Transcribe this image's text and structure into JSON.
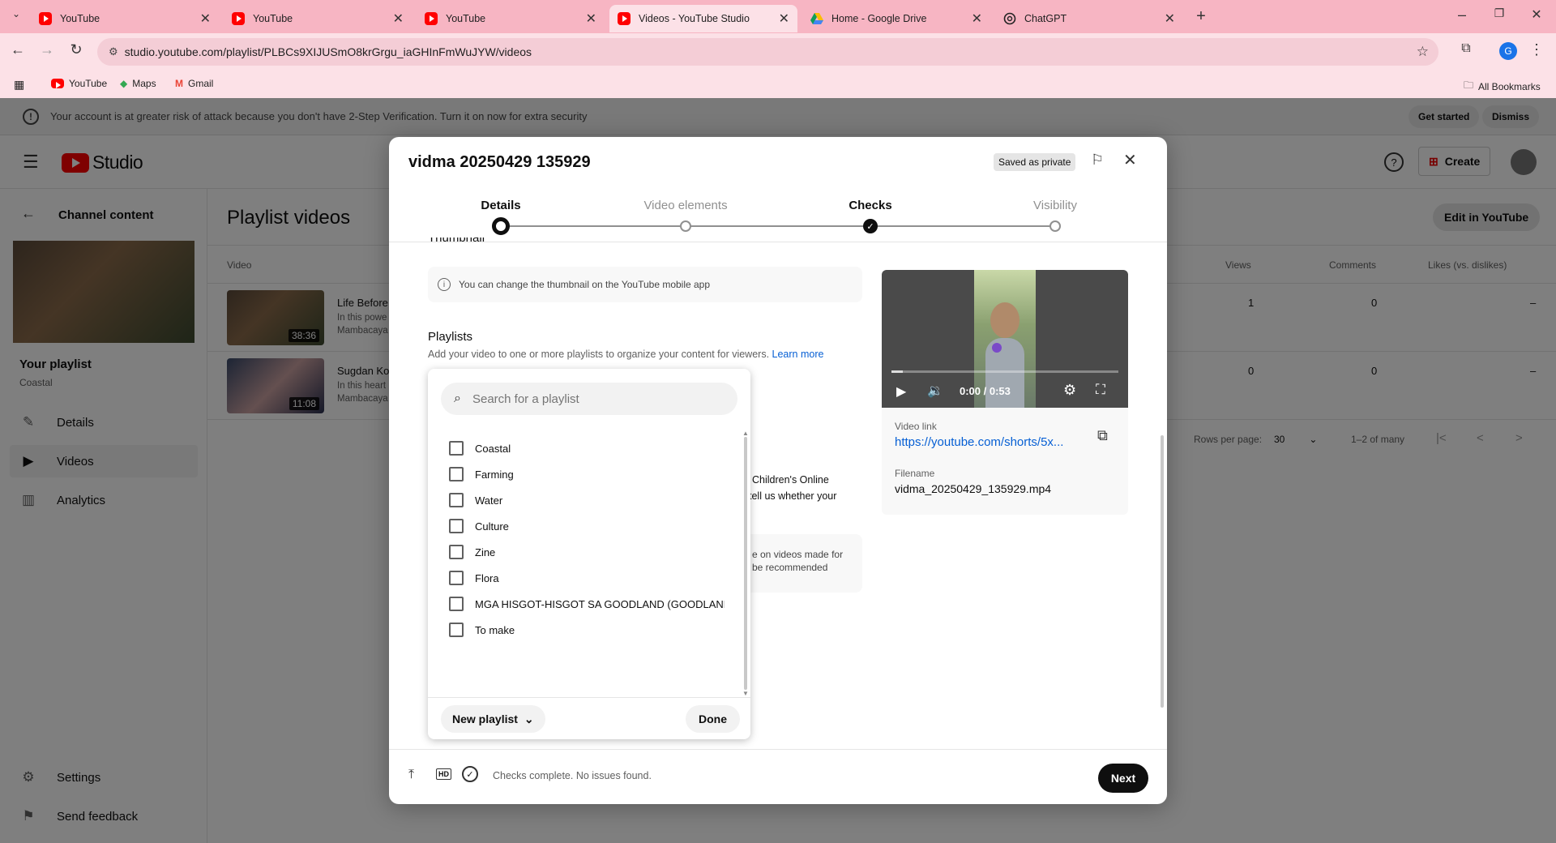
{
  "browser": {
    "tabs": [
      {
        "label": "YouTube",
        "icon": "youtube-icon"
      },
      {
        "label": "YouTube",
        "icon": "youtube-icon"
      },
      {
        "label": "YouTube",
        "icon": "youtube-icon"
      },
      {
        "label": "Videos - YouTube Studio",
        "icon": "youtube-icon"
      },
      {
        "label": "Home - Google Drive",
        "icon": "google-drive-icon"
      },
      {
        "label": "ChatGPT",
        "icon": "chatgpt-icon"
      }
    ],
    "url": "studio.youtube.com/playlist/PLBCs9XIJUSmO8krGrgu_iaGHInFmWuJYW/videos",
    "profile_initial": "G",
    "bookmarks": [
      {
        "label": "YouTube"
      },
      {
        "label": "Maps"
      },
      {
        "label": "Gmail"
      }
    ],
    "all_bookmarks": "All Bookmarks"
  },
  "banner": {
    "text": "Your account is at greater risk of attack because you don't have 2-Step Verification. Turn it on now for extra security",
    "get_started": "Get started",
    "dismiss": "Dismiss"
  },
  "studio": {
    "logo_text": "Studio",
    "create": "Create",
    "channel_content": "Channel content",
    "page_title": "Playlist videos",
    "edit_in_youtube": "Edit in YouTube",
    "playlist_label": "Your playlist",
    "playlist_name": "Coastal",
    "nav": [
      {
        "label": "Details",
        "icon": "pencil-icon"
      },
      {
        "label": "Videos",
        "icon": "videos-icon"
      },
      {
        "label": "Analytics",
        "icon": "analytics-icon"
      }
    ],
    "settings": "Settings",
    "send_feedback": "Send feedback",
    "columns": {
      "video": "Video",
      "views": "Views",
      "comments": "Comments",
      "likes": "Likes (vs. dislikes)"
    },
    "rows": [
      {
        "title": "Life Before",
        "desc1": "In this powe",
        "desc2": "Mambacaya",
        "duration": "38:36",
        "views": "1",
        "comments": "0",
        "likes": "–"
      },
      {
        "title": "Sugdan Ko",
        "desc1": "In this heart",
        "desc2": "Mambacaya",
        "duration": "11:08",
        "views": "0",
        "comments": "0",
        "likes": "–"
      }
    ],
    "rows_per_page_label": "Rows per page:",
    "rows_per_page": "30",
    "range": "1–2 of many"
  },
  "modal": {
    "title": "vidma 20250429 135929",
    "saved_badge": "Saved as private",
    "steps": [
      {
        "label": "Details",
        "state": "current"
      },
      {
        "label": "Video elements",
        "state": "pending"
      },
      {
        "label": "Checks",
        "state": "done"
      },
      {
        "label": "Visibility",
        "state": "pending"
      }
    ],
    "thumbnail_title_partial": "Thumbnail",
    "thumbnail_info": "You can change the thumbnail on the YouTube mobile app",
    "playlists_title": "Playlists",
    "playlists_desc": "Add your video to one or more playlists to organize your content for viewers.",
    "learn_more": "Learn more",
    "hidden_text_1a": "Children's Online",
    "hidden_text_1b": "tell us whether your",
    "hidden_text_2a": "e on videos made for",
    "hidden_text_2b": "be recommended",
    "video": {
      "time": "0:00 / 0:53",
      "progress": 0.05,
      "link_label": "Video link",
      "link": "https://youtube.com/shorts/5x...",
      "filename_label": "Filename",
      "filename": "vidma_20250429_135929.mp4"
    },
    "footer_status": "Checks complete. No issues found.",
    "next": "Next"
  },
  "playlist_dropdown": {
    "search_placeholder": "Search for a playlist",
    "items": [
      {
        "label": "Coastal",
        "checked": false
      },
      {
        "label": "Farming",
        "checked": false
      },
      {
        "label": "Water",
        "checked": false
      },
      {
        "label": "Culture",
        "checked": false
      },
      {
        "label": "Zine",
        "checked": false
      },
      {
        "label": "Flora",
        "checked": false
      },
      {
        "label": "MGA HISGOT-HISGOT SA GOODLAND (GOODLAND T...",
        "checked": false
      },
      {
        "label": "To make",
        "checked": false
      }
    ],
    "new_playlist": "New playlist",
    "done": "Done"
  }
}
